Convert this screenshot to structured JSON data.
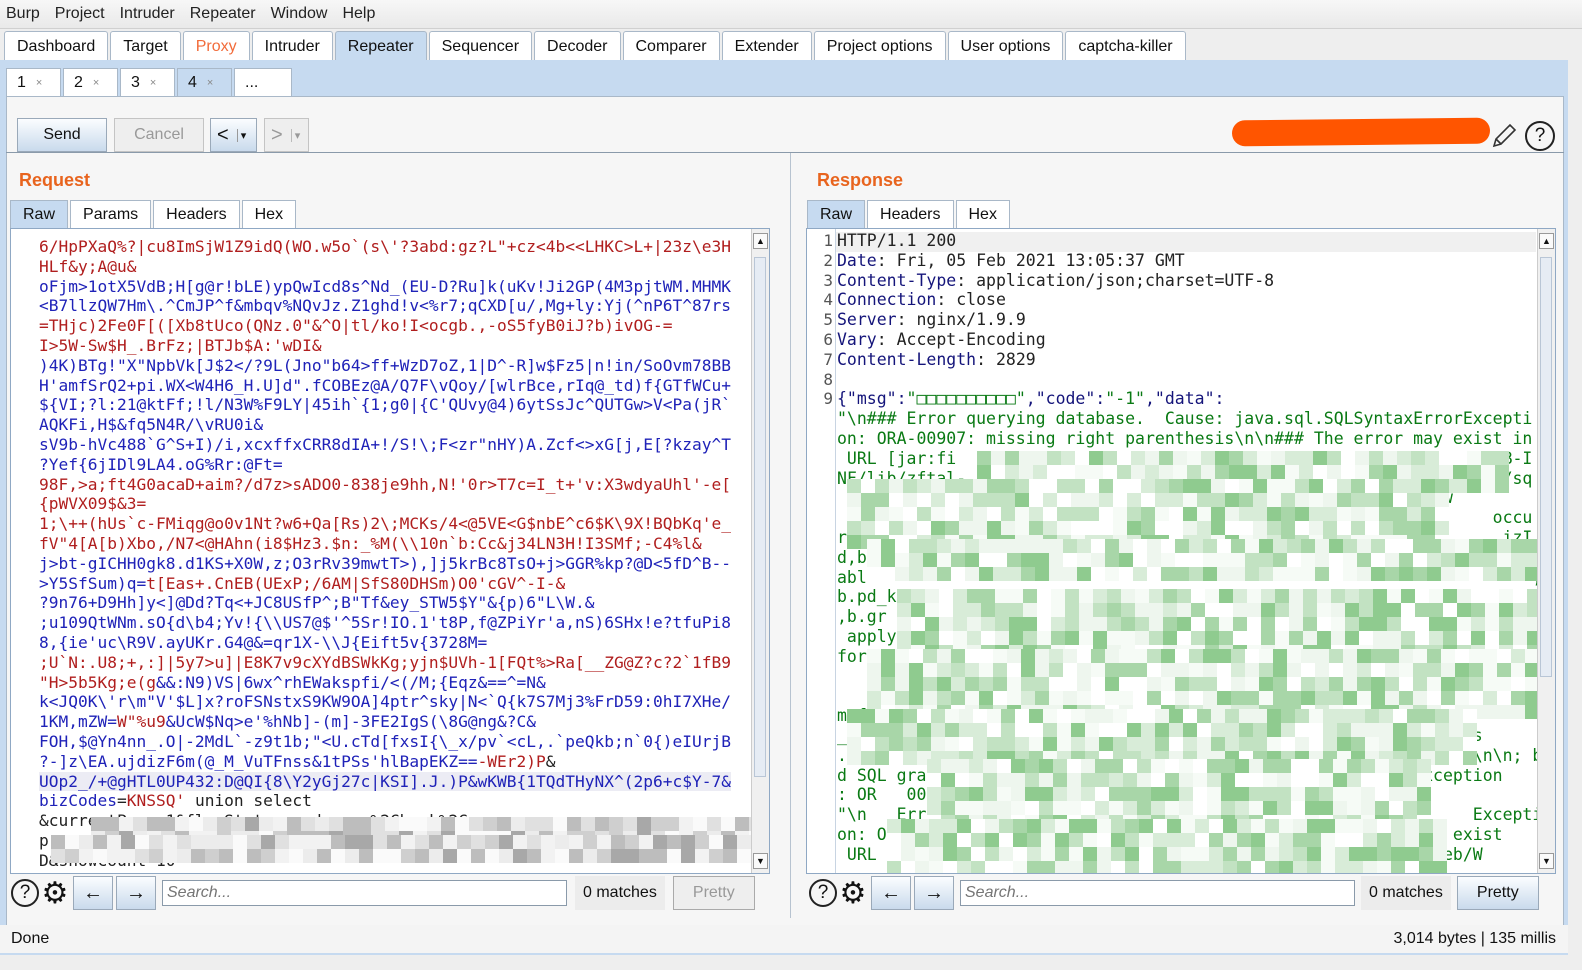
{
  "menu": [
    "Burp",
    "Project",
    "Intruder",
    "Repeater",
    "Window",
    "Help"
  ],
  "main_tabs": [
    {
      "label": "Dashboard"
    },
    {
      "label": "Target"
    },
    {
      "label": "Proxy",
      "highlight": true
    },
    {
      "label": "Intruder"
    },
    {
      "label": "Repeater",
      "selected": true
    },
    {
      "label": "Sequencer"
    },
    {
      "label": "Decoder"
    },
    {
      "label": "Comparer"
    },
    {
      "label": "Extender"
    },
    {
      "label": "Project options"
    },
    {
      "label": "User options"
    },
    {
      "label": "captcha-killer"
    }
  ],
  "repeater_tabs": [
    {
      "label": "1",
      "close": "×"
    },
    {
      "label": "2",
      "close": "×"
    },
    {
      "label": "3",
      "close": "×"
    },
    {
      "label": "4",
      "close": "×",
      "selected": true
    },
    {
      "label": "..."
    }
  ],
  "toolbar": {
    "send": "Send",
    "cancel": "Cancel",
    "back": "<",
    "forward": ">",
    "dropdown": "▾",
    "redacted_color": "#ff5500"
  },
  "request": {
    "title": "Request",
    "tabs": [
      "Raw",
      "Params",
      "Headers",
      "Hex"
    ],
    "lines": [
      [
        {
          "t": "6/HpPXaQ%?|cu8ImSjW1Z9idQ(WO.w5o`(s\\'?3abd:gz?L\"+cz<4b<<LHKC>L+|23z\\e3H",
          "c": "r"
        }
      ],
      [
        {
          "t": "HLf&y;A@u&",
          "c": "r"
        }
      ],
      [
        {
          "t": "oFjm>1otX5VdB;H[g@r!bLE)ypQwIcd8s^Nd_(EU-D?Ru]k(uKv!Ji2GP(4M3pjtWM.MHMK",
          "c": "b"
        }
      ],
      [
        {
          "t": "<B7llzQW7Hm\\.^CmJP^f&mbqv%NQvJz.Z1ghd!v<%r7;qCXD[u/,Mg+ly:Yj(^nP6T^87rs",
          "c": "b"
        }
      ],
      [
        {
          "t": "=THjc)2Fe0F[([Xb8tUco(QNz.0\"&^O|tl/ko!I<ocgb.,-oS5fyB0iJ?b)ivOG-=",
          "c": "r"
        }
      ],
      [
        {
          "t": "I>5W-Sw$H_.BrFz;|BTJb$A:'wDI&",
          "c": "r"
        }
      ],
      [
        {
          "t": ")4K)BTg!\"X\"NpbVk[J$2</?9L(Jno\"b64>ff+WzD7oZ,1|D^-R]w$Fz5|n!in/SoOvm78BB",
          "c": "b"
        }
      ],
      [
        {
          "t": "H'amfSrQ2+pi.WX<W4H6_H.U]d\".fCOBEz@A/Q7F\\vQoy/[wlrBce,rIq@_td)f{GTfWCu+",
          "c": "b"
        }
      ],
      [
        {
          "t": "${VI;?l:21@ktFf;!l/N3W%F9LY|45ih`{1;g0|{C'QUvy@4)6ytSsJc^QUTGw>V<Pa(jR`",
          "c": "b"
        }
      ],
      [
        {
          "t": "AQKFi,H$&fq5N4R/\\vRU0i&",
          "c": "b"
        }
      ],
      [
        {
          "t": "sV9b-hVc488`G^S+I)/i,xcxffxCRR8dIA+!/S!\\;F<zr\"nHY)A.Zcf<>xG[j,E[?kzay^T",
          "c": "b"
        }
      ],
      [
        {
          "t": "?Yef{6jIDl9LA4.oG%Rr:@Ft=",
          "c": "b"
        }
      ],
      [
        {
          "t": "98F,>a;ft4G0acaD+aim?/d7z>sADO0-838je9hh,N!'0r>T7c=I_t+'v:X3wdyaUhl'-e[",
          "c": "r"
        }
      ],
      [
        {
          "t": "{pWVX09$&3=",
          "c": "r"
        }
      ],
      [
        {
          "t": "1;\\++(hUs`c-FMiqg@o0v1Nt?w6+Qa[Rs)2\\;MCKs/4<@5VE<G$nbE^c6$K\\9X!BQbKq'e_",
          "c": "r"
        }
      ],
      [
        {
          "t": "fV\"4[A[b)Xbo,/N7<@HAhn(i8$Hz3.$n:_%M(\\\\10n`b:Cc&j34LN3H!I3SMf;-C4%l&",
          "c": "r"
        }
      ],
      [
        {
          "t": "j>bt-gICHH0gk8.d1KS+X0W,z;O3rRv39mwtT>),]j5krBc8TsO+j>GGR%kp?@D<5fD^B--",
          "c": "b"
        }
      ],
      [
        {
          "t": ">Y5SfSum)q=",
          "c": "b"
        },
        {
          "t": "t[Eas+.CnEB(UExP;/6AM|SfS80DHSm)O0'cGV^-I-&",
          "c": "r"
        }
      ],
      [
        {
          "t": "?9n76+D9Hh]y<]@Dd?Tq<+JC8USfP^;B\"Tf&ey_STW5$Y\"&{p)6\"L\\W.&",
          "c": "b"
        }
      ],
      [
        {
          "t": ";u109QtWNm.sO{d\\b4;Yv!{\\\\US7@$'^5Sr!IO.1't8P,f@ZPiYr'a,nS)6SHx!e?tfuPi8",
          "c": "b"
        }
      ],
      [
        {
          "t": "8,{ie'uc\\R9V.ayUKr.G4@&=qr1X-\\\\J{Eift5v{3728M=",
          "c": "b"
        }
      ],
      [
        {
          "t": ";U`N:.U8;+,:]|5y7>u]|E8K7v9cXYdBSWkKg;yjn$UVh-1[FQt%>Ra[__ZG@Z?c?2`1fB9",
          "c": "r"
        }
      ],
      [
        {
          "t": "\"H>5b5Kg;e(g",
          "c": "r"
        },
        {
          "t": "&&:N9)VS|6wx^rhEWakspfi/<(/M;{Eqz&==^=N&",
          "c": "b"
        }
      ],
      [
        {
          "t": "k<JQ0K\\'r\\m\"V'$L]x?roFSNstxS9KW9OA]4ptr^sky|N<`Q{k7S7Mj3%FrD59:0hI7XHe/",
          "c": "b"
        }
      ],
      [
        {
          "t": "1KM,mZW=",
          "c": "b"
        },
        {
          "t": "W\"%u9",
          "c": "r"
        },
        {
          "t": "&UcW$Nq>e'%hNb]-(m]-3FE2IgS(\\8G@ng&?C&",
          "c": "b"
        }
      ],
      [
        {
          "t": "FOH,$@Yn4nn_.O|-2MdL`-z9t1b;\"<U.cTd[fxsI{\\_x/pv`<cL,.`peQkb;n`0{)eIUrjB",
          "c": "b"
        }
      ],
      [
        {
          "t": "?-]z\\EA.ujdizF6m(@_M_VuTFnss&1tPSs'hlBapEKZ==",
          "c": "b"
        },
        {
          "t": "-WEr2)P",
          "c": "r"
        },
        {
          "t": "&",
          "c": "k"
        }
      ],
      [
        {
          "t": "UOp2_/+@gHTL0UP432:D@QI{8\\Y2yGj27c|KSI].J.)P&wKWB{1TQdTHyNX^(2p6+c$Y-7&",
          "c": "b",
          "hl": true
        }
      ],
      [
        {
          "t": "bizCodes",
          "c": "b"
        },
        {
          "t": "=",
          "c": "k"
        },
        {
          "t": "KNSSQ'",
          "c": "r"
        },
        {
          "t": " union select",
          "c": "k"
        }
      ],
      [
        {
          "t": "&currentPage=1&flowStatus=underway%2Cback%2C",
          "c": "k"
        }
      ],
      [
        {
          "t": "p",
          "c": "k"
        }
      ],
      [
        {
          "t": "D&showCount=10",
          "c": "k"
        }
      ]
    ],
    "search_placeholder": "Search...",
    "matches": "0 matches",
    "pretty": "Pretty"
  },
  "response": {
    "title": "Response",
    "tabs": [
      "Raw",
      "Headers",
      "Hex"
    ],
    "line_numbers": [
      "1",
      "2",
      "3",
      "4",
      "5",
      "6",
      "7",
      "8",
      "9"
    ],
    "lines": [
      [
        {
          "t": "HTTP/1.1 200",
          "c": "k"
        }
      ],
      [
        {
          "t": "Date",
          "c": "kb"
        },
        {
          "t": ": Fri, 05 Feb 2021 13:05:37 GMT",
          "c": "k"
        }
      ],
      [
        {
          "t": "Content-Type",
          "c": "kb"
        },
        {
          "t": ": application/json;charset=UTF-8",
          "c": "k"
        }
      ],
      [
        {
          "t": "Connection",
          "c": "kb"
        },
        {
          "t": ": close",
          "c": "k"
        }
      ],
      [
        {
          "t": "Server",
          "c": "kb"
        },
        {
          "t": ": nginx/1.9.9",
          "c": "k"
        }
      ],
      [
        {
          "t": "Vary",
          "c": "kb"
        },
        {
          "t": ": Accept-Encoding",
          "c": "k"
        }
      ],
      [
        {
          "t": "Content-Length",
          "c": "kb"
        },
        {
          "t": ": 2829",
          "c": "k"
        }
      ],
      [
        {
          "t": "",
          "c": "k"
        }
      ],
      [
        {
          "t": "{\"msg\":",
          "c": "kb"
        },
        {
          "t": "\"□□□□□□□□□□\"",
          "c": "g"
        },
        {
          "t": ",\"code\":",
          "c": "kb"
        },
        {
          "t": "\"-1\"",
          "c": "g"
        },
        {
          "t": ",\"data\":",
          "c": "kb"
        }
      ],
      [
        {
          "t": "\"\\n### Error querying database.  Cause: java.sql.SQLSyntaxErrorExcepti",
          "c": "g"
        }
      ],
      [
        {
          "t": "on: ORA-00907: missing right parenthesis\\n\\n### The error may exist in",
          "c": "g"
        }
      ],
      [
        {
          "t": " URL [jar:fi                                                       B-I",
          "c": "g"
        }
      ],
      [
        {
          "t": "NF/lib/zftal-                                                     b/sq",
          "c": "g"
        }
      ],
      [
        {
          "t": "                    The error may involve com.zfsoft.xgxt.flow",
          "c": "g"
        }
      ],
      [
        {
          "t": "                                                                  occu",
          "c": "g"
        }
      ],
      [
        {
          "t": "rred while setting parameters                                      izI",
          "c": "g"
        }
      ],
      [
        {
          "t": "d,b.biz_code as bizCode,b.biz_name as bizName,b.biz_table_name as bizT",
          "c": "g"
        }
      ],
      [
        {
          "t": "abl                                                                   ,",
          "c": "g"
        }
      ],
      [
        {
          "t": "b.pd_key as pdKey                                                    de",
          "c": "g"
        }
      ],
      [
        {
          "t": ",b.gr                      formId,b.apply_table_heade  as",
          "c": "g"
        }
      ],
      [
        {
          "t": " apply                                    Header,       f.",
          "c": "g"
        }
      ],
      [
        {
          "t": "form_code as for         form_name as                   table_hea",
          "c": "g"
        }
      ],
      [
        {
          "t": "                                                           resultMo",
          "c": "g"
        }
      ],
      [
        {
          "t": "                                      biz b left join dynamic for",
          "c": "g"
        }
      ],
      [
        {
          "t": "m f   b.form_      .form_",
          "c": "g"
        }
      ],
      [
        {
          "t": "_co    in      (          KNSSQ  nion    ec           )\\n### Caus",
          "c": "g"
        }
      ],
      [
        {
          "t": ".SQ  ntaxErrorExcepti          0907  mis                        \\n\\n; ba",
          "c": "g"
        }
      ],
      [
        {
          "t": "d SQL gram                                  SQLSyntaxErrorException",
          "c": "g"
        }
      ],
      [
        {
          "t": ": OR   00     ing right paren          \",",
          "c": "g"
        },
        {
          "t": "\"message\"",
          "c": "kb"
        },
        {
          "t": ":",
          "c": "k"
        }
      ],
      [
        {
          "t": "\"\\n   Error q                                                   Excepti",
          "c": "g"
        }
      ],
      [
        {
          "t": "on: ORA-00907: missing right parenthesis\\n\\n                  exist",
          "c": "g"
        }
      ],
      [
        {
          "t": " URL                                                   xgxt-web/W",
          "c": "g"
        }
      ]
    ],
    "search_placeholder": "Search...",
    "matches": "0 matches",
    "pretty": "Pretty"
  },
  "status": {
    "left": "Done",
    "right": "3,014 bytes | 135 millis"
  },
  "colors": {
    "accent_orange": "#e8641e",
    "tab_selected": "#c6daf0",
    "request_red": "#b01e1e",
    "request_blue": "#1f22b8",
    "response_green": "#0a7a14"
  }
}
